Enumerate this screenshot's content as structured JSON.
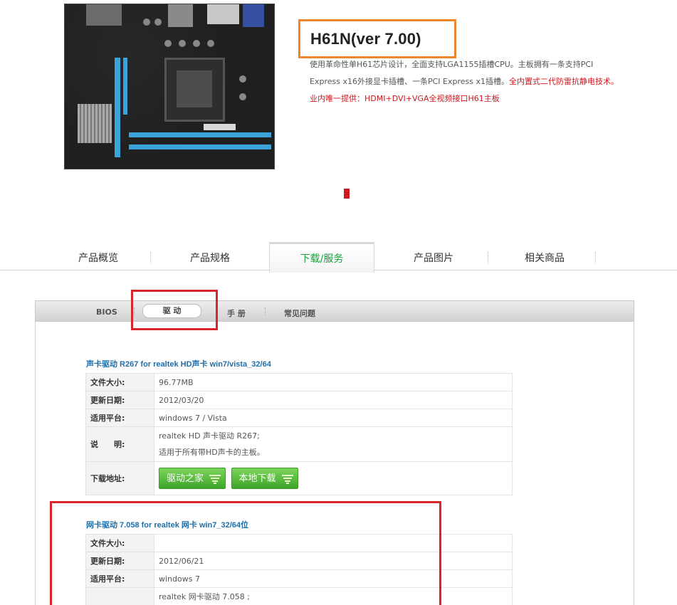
{
  "product": {
    "title": "H61N(ver 7.00)",
    "desc_line1": "使用革命性单H61芯片设计，全面支持LGA1155插槽CPU。主板拥有一条支持PCI",
    "desc_line2_normal": "Express x16外接显卡插槽、一条PCI Express x1插槽。",
    "desc_line2_red": "全内置式二代防雷抗静电技术。",
    "desc_line3_red": "业内唯一提供：HDMI+DVI+VGA全视频接口H61主板",
    "accent_orange": "#f0862b",
    "accent_red": "#d0171e"
  },
  "tabs": [
    {
      "label": "产品概览"
    },
    {
      "label": "产品规格"
    },
    {
      "label": "下载/服务",
      "active": true
    },
    {
      "label": "产品图片"
    },
    {
      "label": "相关商品"
    }
  ],
  "subtabs": [
    {
      "label": "BIOS"
    },
    {
      "label": "驱 动",
      "active": true
    },
    {
      "label": "手 册"
    },
    {
      "label": "常见问题"
    }
  ],
  "driver1": {
    "title": "声卡驱动 R267 for realtek HD声卡 win7/vista_32/64",
    "rows": {
      "size_key": "文件大小:",
      "size_val": "96.77MB",
      "date_key": "更新日期:",
      "date_val": "2012/03/20",
      "platform_key": "适用平台:",
      "platform_val": "windows 7 / Vista",
      "note_key": "说　　明:",
      "note_val1": "realtek HD 声卡驱动 R267;",
      "note_val2": "适用于所有带HD声卡的主板。",
      "download_key": "下载地址:"
    },
    "buttons": {
      "home": "驱动之家",
      "local": "本地下载"
    }
  },
  "driver2": {
    "title": "网卡驱动 7.058 for realtek 网卡 win7_32/64位",
    "rows": {
      "size_key": "文件大小:",
      "size_val": "",
      "date_key": "更新日期:",
      "date_val": "2012/06/21",
      "platform_key": "适用平台:",
      "platform_val": "windows 7",
      "note_val1": "realtek 网卡驱动 7.058 ;"
    }
  }
}
